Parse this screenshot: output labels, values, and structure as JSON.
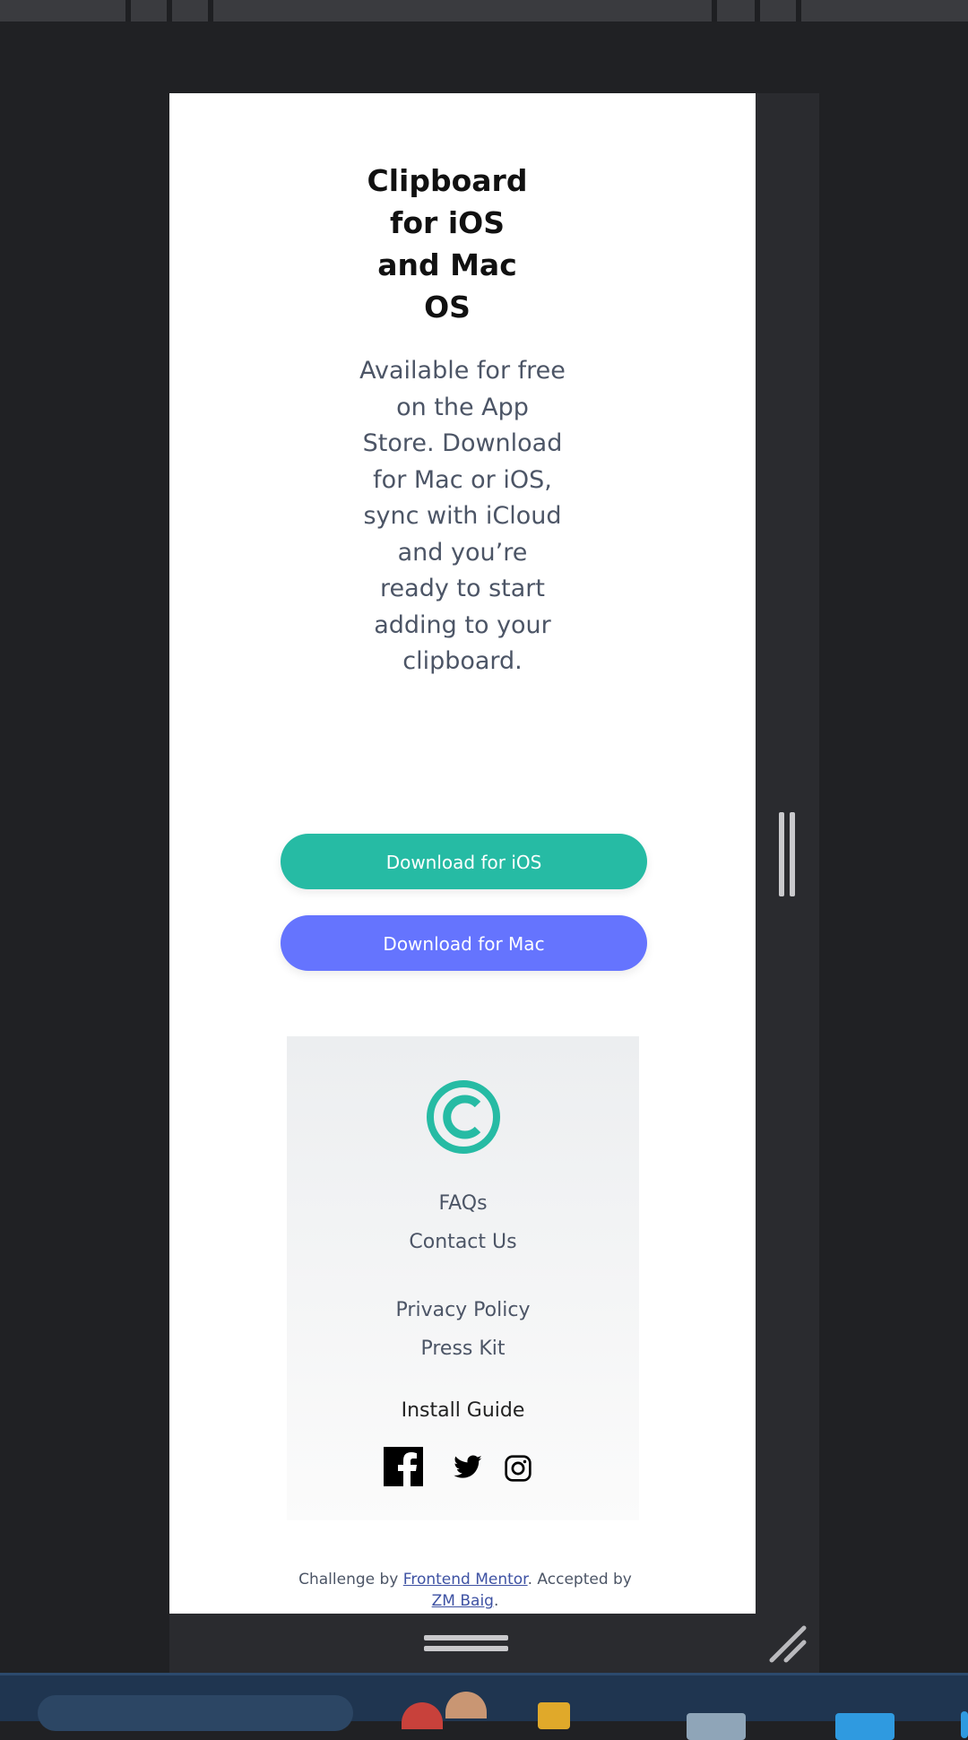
{
  "hero": {
    "title": "Clipboard for iOS and Mac OS",
    "text": "Available for free on the App Store. Download for Mac or iOS, sync with iCloud and you’re ready to start adding to your clipboard."
  },
  "buttons": {
    "ios": "Download for iOS",
    "mac": "Download for Mac"
  },
  "footer": {
    "links": [
      "FAQs",
      "Contact Us",
      "Privacy Policy",
      "Press Kit",
      "Install Guide"
    ],
    "social": [
      "facebook-icon",
      "twitter-icon",
      "instagram-icon"
    ]
  },
  "attribution": {
    "prefix": "Challenge by",
    "link1": "Frontend Mentor",
    "middle": ". Accepted by",
    "link2": "ZM Baig",
    "suffix": "."
  },
  "colors": {
    "accent_green": "#26bba4",
    "accent_blue": "#6574fe",
    "frame_dark": "#202124",
    "taskbar": "#1f3550"
  }
}
